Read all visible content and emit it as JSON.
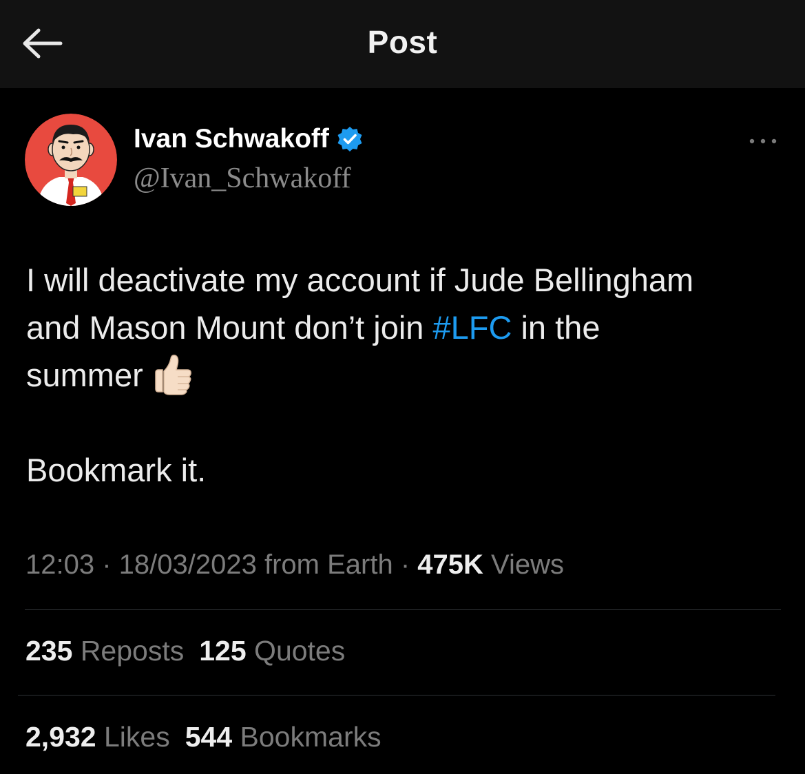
{
  "header": {
    "title": "Post",
    "back_icon": "arrow-left-icon"
  },
  "author": {
    "name": "Ivan Schwakoff",
    "handle": "@Ivan_Schwakoff",
    "verified_icon": "verified-badge-icon",
    "avatar_icon": "cartoon-man-avatar"
  },
  "tweet": {
    "line1": "I will deactivate my account if Jude Bellingham",
    "line2_before": "and Mason Mount don’t join ",
    "hashtag": "#LFC",
    "line2_after": " in the",
    "line3": "summer",
    "line4": "Bookmark it.",
    "emoji": "thumbs-up-icon"
  },
  "meta": {
    "time": "12:03",
    "sep1": " · ",
    "date": "18/03/2023",
    "source": " from Earth",
    "sep2": " · ",
    "views_count": "475K",
    "views_label": " Views"
  },
  "stats": {
    "reposts_count": "235",
    "reposts_label": " Reposts",
    "quotes_count": "125",
    "quotes_label": " Quotes",
    "likes_count": "2,932",
    "likes_label": " Likes",
    "bookmarks_count": "544",
    "bookmarks_label": " Bookmarks"
  },
  "colors": {
    "background": "#000000",
    "header_bg": "#121212",
    "hashtag": "#1d9bf0",
    "verified": "#1d9bf0",
    "muted_text": "#7c7c7c"
  }
}
